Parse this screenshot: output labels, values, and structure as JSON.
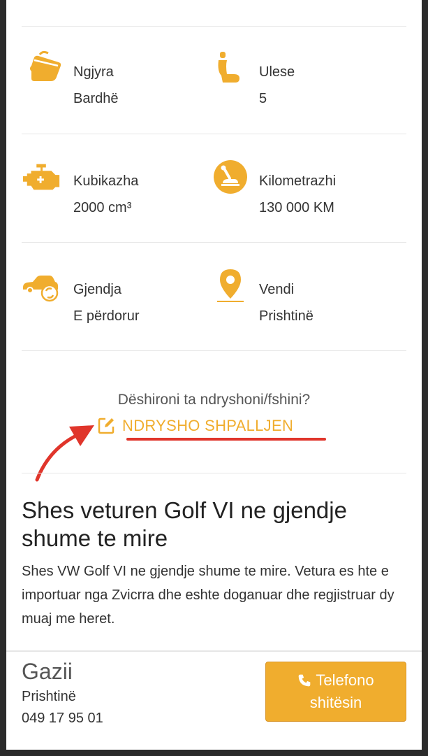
{
  "specs": [
    {
      "label": "Ngjyra",
      "value": "Bardhë",
      "icon": "paint-bucket-icon"
    },
    {
      "label": "Ulese",
      "value": "5",
      "icon": "car-seat-icon"
    },
    {
      "label": "Kubikazha",
      "value": "2000 cm³",
      "icon": "engine-icon"
    },
    {
      "label": "Kilometrazhi",
      "value": "130 000 KM",
      "icon": "gear-shift-icon"
    },
    {
      "label": "Gjendja",
      "value": "E përdorur",
      "icon": "car-condition-icon"
    },
    {
      "label": "Vendi",
      "value": "Prishtinë",
      "icon": "location-pin-icon"
    }
  ],
  "edit": {
    "question": "Dëshironi ta ndryshoni/fshini?",
    "link_label": "NDRYSHO SHPALLJEN"
  },
  "ad": {
    "title": "Shes veturen Golf VI ne gjendje shume te mire",
    "description": "Shes VW Golf VI ne gjendje shume te mire. Vetura es hte e importuar nga Zvicrra dhe eshte doganuar dhe regjistruar dy muaj me heret."
  },
  "seller": {
    "name": "Gazii",
    "city": "Prishtinë",
    "phone": "049 17 95 01"
  },
  "call_button": {
    "line1": "Telefono",
    "line2": "shitësin"
  },
  "colors": {
    "accent": "#f0ad2e",
    "annotation": "#e0352b"
  }
}
